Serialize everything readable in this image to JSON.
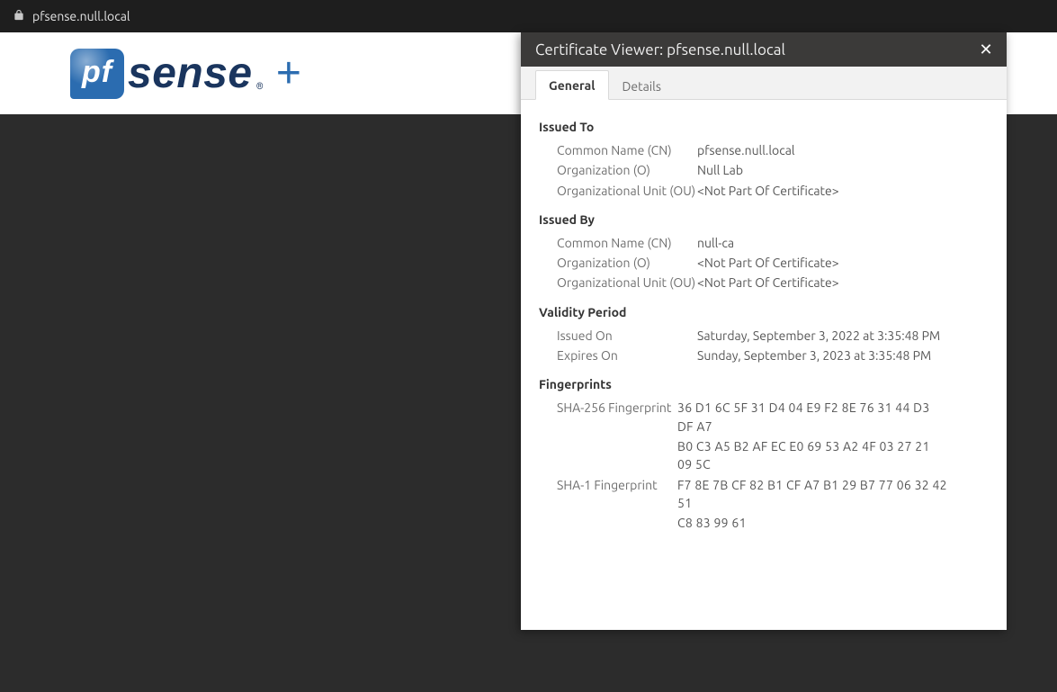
{
  "urlbar": {
    "address": "pfsense.null.local"
  },
  "logo": {
    "pf": "pf",
    "sense": "sense",
    "reg": "®",
    "plus": "+"
  },
  "dialog": {
    "title_prefix": "Certificate Viewer: ",
    "title_host": "pfsense.null.local",
    "tabs": {
      "general": "General",
      "details": "Details"
    },
    "issued_to": {
      "heading": "Issued To",
      "cn_label": "Common Name (CN)",
      "cn_value": "pfsense.null.local",
      "o_label": "Organization (O)",
      "o_value": "Null Lab",
      "ou_label": "Organizational Unit (OU)",
      "ou_value": "<Not Part Of Certificate>"
    },
    "issued_by": {
      "heading": "Issued By",
      "cn_label": "Common Name (CN)",
      "cn_value": "null-ca",
      "o_label": "Organization (O)",
      "o_value": "<Not Part Of Certificate>",
      "ou_label": "Organizational Unit (OU)",
      "ou_value": "<Not Part Of Certificate>"
    },
    "validity": {
      "heading": "Validity Period",
      "issued_label": "Issued On",
      "issued_value": "Saturday, September 3, 2022 at 3:35:48 PM",
      "expires_label": "Expires On",
      "expires_value": "Sunday, September 3, 2023 at 3:35:48 PM"
    },
    "fingerprints": {
      "heading": "Fingerprints",
      "sha256_label": "SHA-256 Fingerprint",
      "sha256_line1": "36 D1 6C 5F 31 D4 04 E9 F2 8E 76 31 44 D3 DF A7",
      "sha256_line2": "B0 C3 A5 B2 AF EC E0 69 53 A2 4F 03 27 21 09 5C",
      "sha1_label": "SHA-1 Fingerprint",
      "sha1_line1": "F7 8E 7B CF 82 B1 CF A7 B1 29 B7 77 06 32 42 51",
      "sha1_line2": "C8 83 99 61"
    }
  }
}
